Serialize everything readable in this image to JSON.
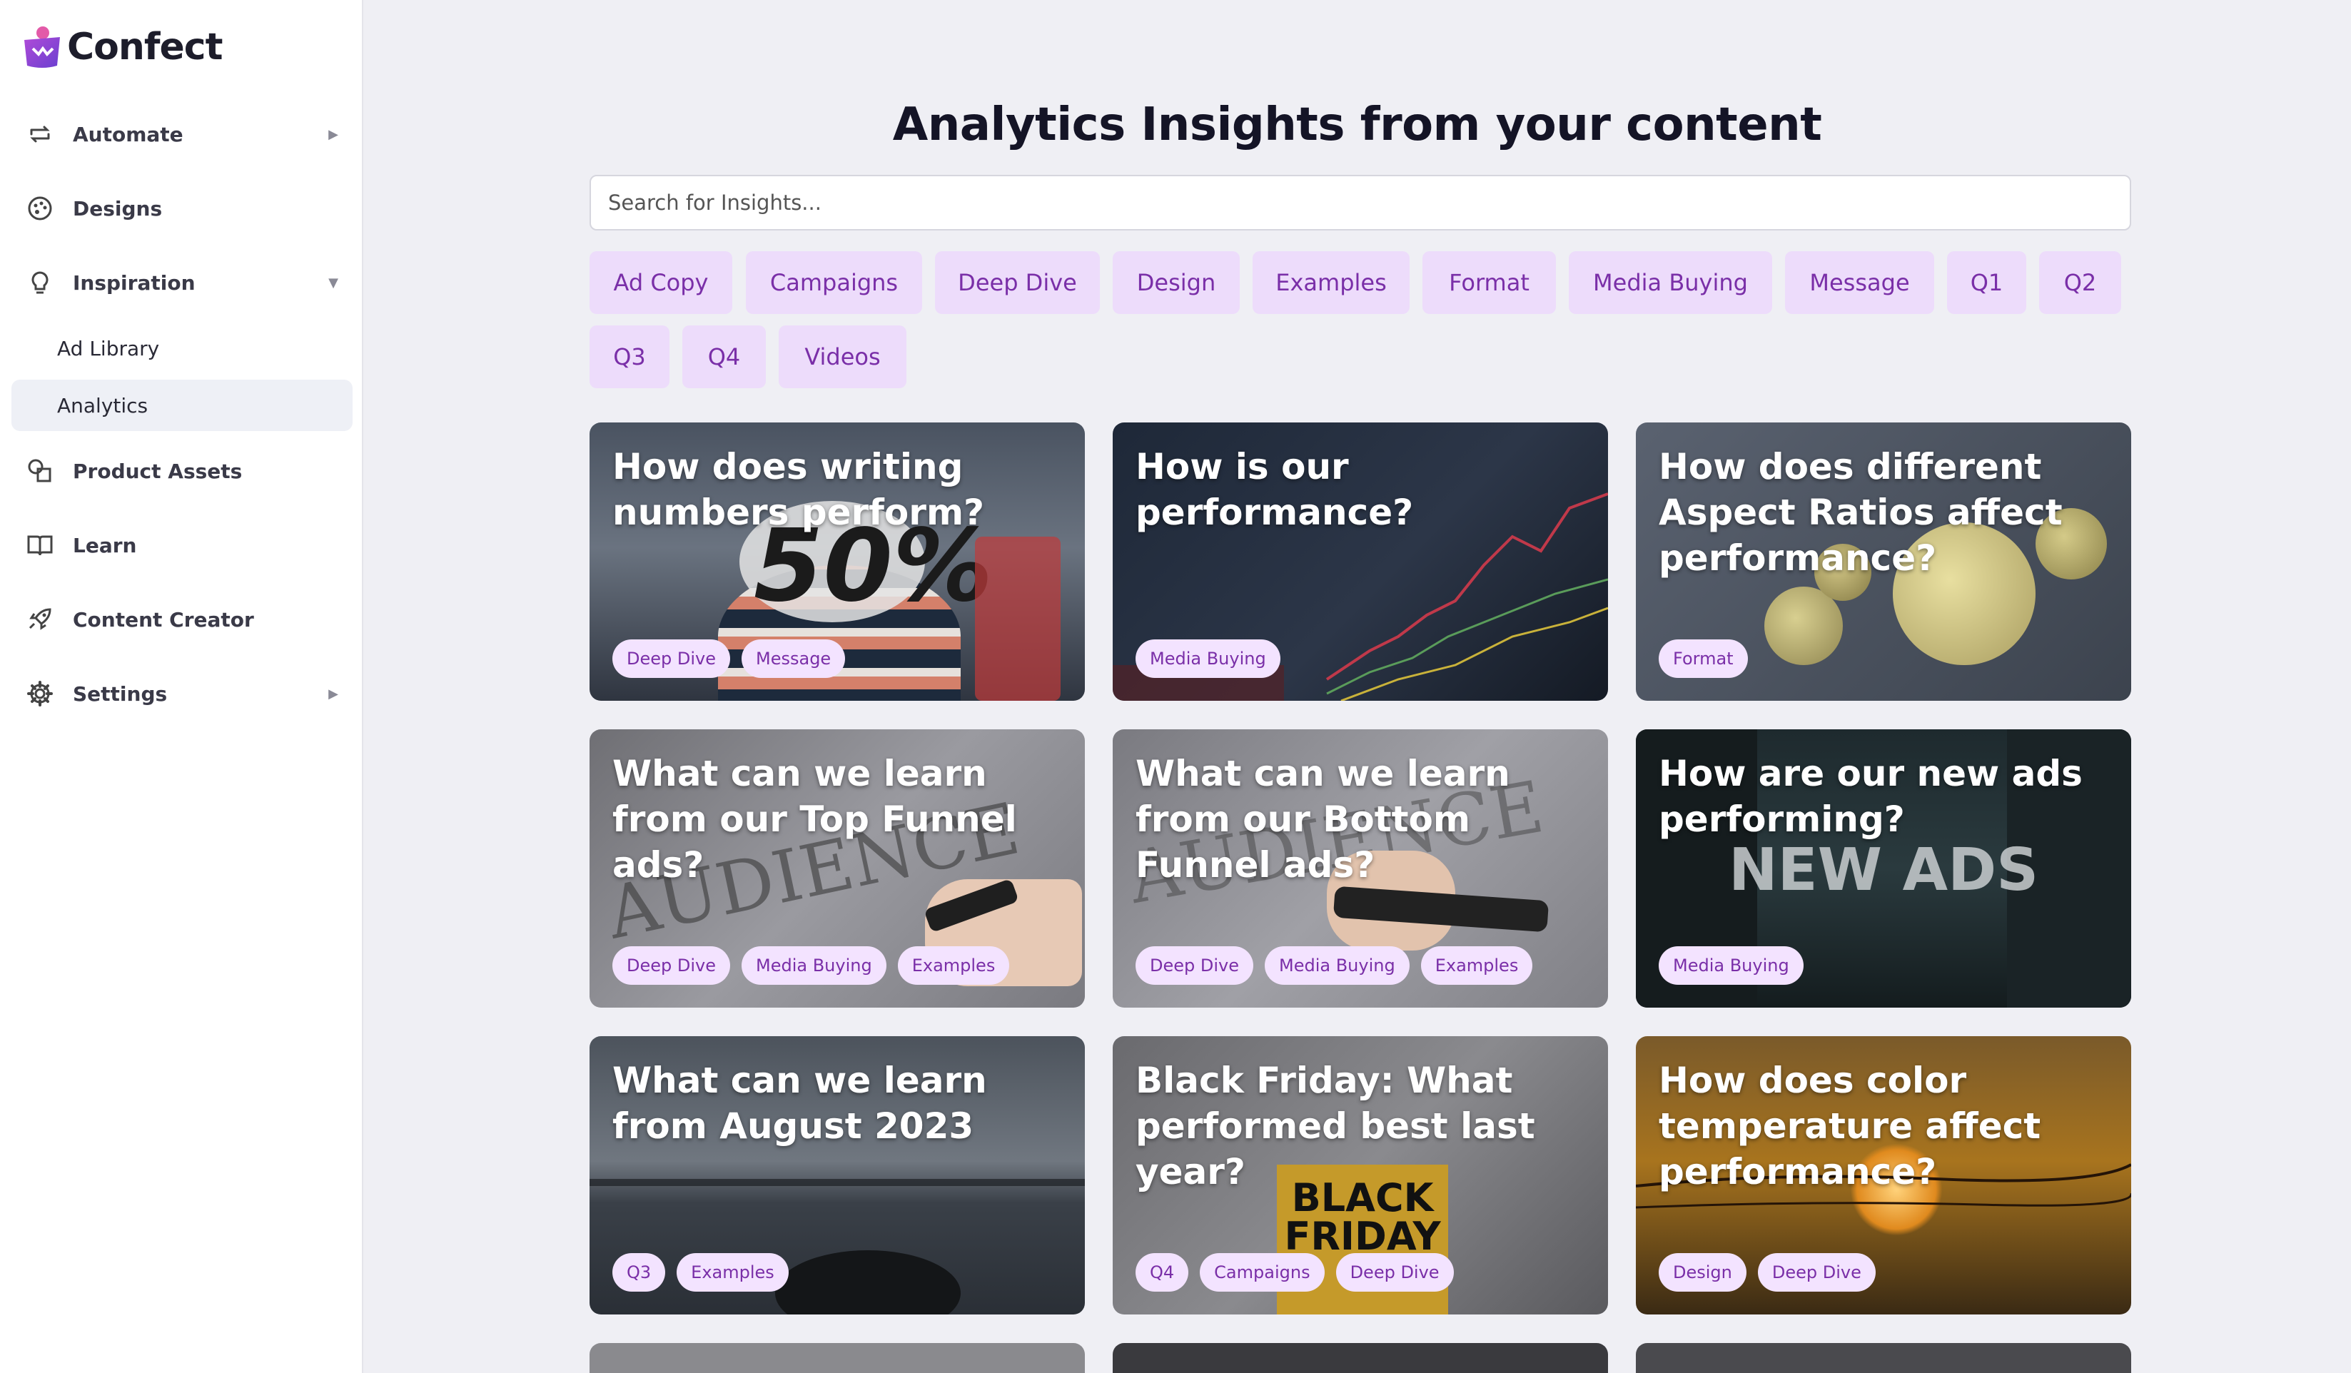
{
  "app": {
    "name": "Confect"
  },
  "sidebar": {
    "items": [
      {
        "label": "Automate",
        "caret": "▶"
      },
      {
        "label": "Designs"
      },
      {
        "label": "Inspiration",
        "caret": "▼"
      },
      {
        "label": "Ad Library"
      },
      {
        "label": "Analytics"
      },
      {
        "label": "Product Assets"
      },
      {
        "label": "Learn"
      },
      {
        "label": "Content Creator"
      },
      {
        "label": "Settings",
        "caret": "▶"
      }
    ]
  },
  "main": {
    "title": "Analytics Insights from your content",
    "search_placeholder": "Search for Insights...",
    "filters": [
      "Ad Copy",
      "Campaigns",
      "Deep Dive",
      "Design",
      "Examples",
      "Format",
      "Media Buying",
      "Message",
      "Q1",
      "Q2",
      "Q3",
      "Q4",
      "Videos"
    ],
    "cards": [
      {
        "title": "How does writing numbers perform?",
        "tags": [
          "Deep Dive",
          "Message"
        ],
        "overlay_text": "50%"
      },
      {
        "title": "How is our performance?",
        "tags": [
          "Media Buying"
        ]
      },
      {
        "title": "How does different Aspect Ratios affect performance?",
        "tags": [
          "Format"
        ]
      },
      {
        "title": "What can we learn from our Top Funnel ads?",
        "tags": [
          "Deep Dive",
          "Media Buying",
          "Examples"
        ],
        "overlay_text": "AUDIENCE"
      },
      {
        "title": "What can we learn from our Bottom Funnel ads?",
        "tags": [
          "Deep Dive",
          "Media Buying",
          "Examples"
        ],
        "overlay_text": "AUDIENCE"
      },
      {
        "title": "How are our new ads performing?",
        "tags": [
          "Media Buying"
        ],
        "overlay_text": "NEW ADS"
      },
      {
        "title": "What can we learn from August 2023",
        "tags": [
          "Q3",
          "Examples"
        ]
      },
      {
        "title": "Black Friday: What performed best last year?",
        "tags": [
          "Q4",
          "Campaigns",
          "Deep Dive"
        ],
        "overlay_text": "BLACK FRIDAY"
      },
      {
        "title": "How does color temperature affect performance?",
        "tags": [
          "Design",
          "Deep Dive"
        ]
      }
    ]
  },
  "colors": {
    "accent": "#7a2fa8",
    "chip_bg": "#eddcfb",
    "page_bg": "#efeff4"
  }
}
